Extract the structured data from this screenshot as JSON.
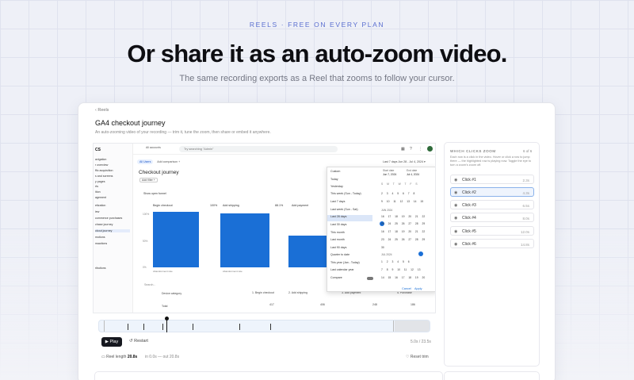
{
  "hero": {
    "eyebrow": "REELS · FREE ON EVERY PLAN",
    "headline": "Or share it as an auto-zoom video.",
    "subhead": "The same recording exports as a Reel that zooms to follow your cursor."
  },
  "card": {
    "back_label": "‹  Reels",
    "title": "GA4 checkout journey",
    "description": "An auto-zooming video of your recording — trim it, tune the zoom, then share or embed it anywhere."
  },
  "screenshot": {
    "sidebar_logo": "CS",
    "sidebar_items": [
      "avigation",
      "r overview",
      "ffic acquisition",
      "s and screens",
      "y pages",
      "rts",
      "ition",
      "agement",
      "etization",
      "iew",
      "commerce purchases",
      "chase journey",
      "ckout journey",
      "motions",
      "nsactions",
      "ributions"
    ],
    "property_label": "All accounts",
    "search_placeholder": "Try searching \"Admin\"",
    "filter_chip": "All Users",
    "add_comparison": "Add comparison  +",
    "date_range": "Last 7 days  Jun 28 - Jul 4, 2024  ▾",
    "report_title": "Checkout journey",
    "add_filter": "Add filter +",
    "funnel_label": "Show open funnel",
    "y_ticks": [
      "100%",
      "50%",
      "0%"
    ],
    "steps": [
      {
        "label": "Begin checkout",
        "pct": "100%",
        "abandon": "Abandonment rate"
      },
      {
        "label": "Add shipping",
        "pct": "88.1%",
        "abandon": "Abandonment rate"
      },
      {
        "label": "Add payment",
        "pct": "",
        "abandon": ""
      }
    ],
    "table_search": "Search...",
    "table_rows": [
      "Device category",
      "Total"
    ],
    "table_headers": [
      "1. Begin checkout",
      "2. Add shipping",
      "3. Add payment",
      "4. Purchase"
    ],
    "table_values": [
      "417",
      "406",
      "248",
      "186"
    ],
    "dropdown": {
      "options": [
        "Custom",
        "Today",
        "Yesterday",
        "This week (Sun - Today)",
        "Last 7 days",
        "Last week (Sun - Sat)",
        "Last 28 days",
        "Last 30 days",
        "This month",
        "Last month",
        "Last 90 days",
        "Quarter to date",
        "This year (Jan - Today)",
        "Last calendar year",
        "Compare"
      ],
      "selected_index": 6,
      "start_label": "Start date",
      "start_value": "Jun 7, 2024",
      "end_label": "End date",
      "end_value": "Jul 4, 2024",
      "weekdays": "S M T W T F S",
      "month_jun": "JUN 2024",
      "month_jul": "JUL 2024",
      "rows": [
        "2 3 4 5 6 7 8",
        "9 10 11 12 13 14 15",
        "16 17 18 19 20 21 22",
        "23 24 25 26 27 28 29",
        "30"
      ],
      "rows_jul": [
        "1 2 3 4 5 6",
        "7 8 9 10 11 12 13",
        "14 15 16 17 18 19 20"
      ],
      "cancel": "Cancel",
      "apply": "Apply"
    }
  },
  "player": {
    "play_label": "▶ Play",
    "restart_label": "↺  Restart",
    "zoom_readout": "5.0s / 23.5s",
    "reel_length_label": "Reel length",
    "reel_length_value": "20.8s",
    "in_out": "in 0.0s — out 20.8s",
    "reset_label": "Reset trim",
    "progress": 0.22
  },
  "panel": {
    "title": "WHICH CLICKS ZOOM",
    "count": "6 of 6",
    "description": "Each row is a click in the video. Hover or click a row to jump there — the highlighted row is playing now. Toggle the eye to turn a zoom's zoom off.",
    "clicks": [
      {
        "name": "Click #1",
        "time": "2.3s"
      },
      {
        "name": "Click #2",
        "time": "4.3s"
      },
      {
        "name": "Click #3",
        "time": "6.5s"
      },
      {
        "name": "Click #4",
        "time": "8.0s"
      },
      {
        "name": "Click #5",
        "time": "12.0s"
      },
      {
        "name": "Click #6",
        "time": "14.8s"
      }
    ],
    "selected_index": 1
  },
  "colors": {
    "accent": "#1a6fd6",
    "eyebrow": "#5b6fd0",
    "play_button": "#16181f"
  }
}
